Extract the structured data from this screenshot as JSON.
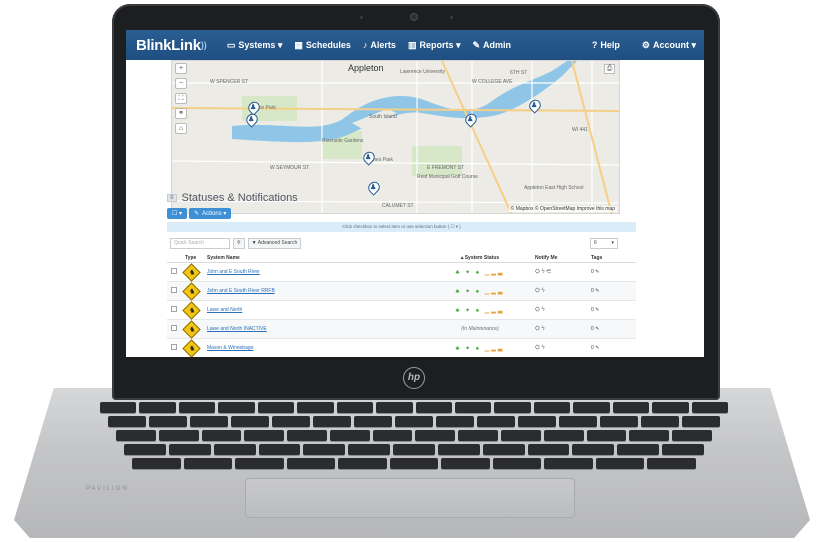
{
  "device": {
    "brand_logo": "hp",
    "model_text": "PAVILION"
  },
  "nav": {
    "brand": "BlinkLink",
    "brand_accent": "))",
    "items": [
      {
        "label": "Systems ▾",
        "icon": "monitor-icon"
      },
      {
        "label": "Schedules",
        "icon": "calendar-icon"
      },
      {
        "label": "Alerts",
        "icon": "bell-icon"
      },
      {
        "label": "Reports ▾",
        "icon": "bar-chart-icon"
      },
      {
        "label": "Admin",
        "icon": "wrench-icon"
      }
    ],
    "right": [
      {
        "label": "Help",
        "icon": "question-icon"
      },
      {
        "label": "Account ▾",
        "icon": "gear-icon"
      }
    ]
  },
  "map": {
    "city": "Appleton",
    "attribution": "© Mapbox © OpenStreetMap Improve this map",
    "labels": [
      "W SPENCER ST",
      "Pierce Park",
      "Riverside Gardens",
      "W SEYMOUR ST",
      "Jones Park",
      "South Island",
      "Lawrence University",
      "E FREMONT ST",
      "Reid Municipal Golf Course",
      "CALUMET ST",
      "Appleton East High School",
      "W COLLEGE AVE",
      "6TH ST",
      "WI 441"
    ]
  },
  "section": {
    "title": "Statuses & Notifications",
    "toggle": "≡",
    "buttons": [
      {
        "label": "☐ ▾"
      },
      {
        "label": "Actions ▾",
        "icon": "wrench-icon"
      }
    ],
    "info": "Click checkbox to select item or use selection button ( ☐ ▾ )",
    "quick_search_placeholder": "Quick Search",
    "advanced_search": "Advanced Search",
    "page_size": "6"
  },
  "grid": {
    "headers": [
      "Type",
      "System Name",
      "▴ System Status",
      "Notify Me",
      "Tags"
    ],
    "rows": [
      {
        "name": "John and E South River",
        "status": "icons",
        "notify": "⛭ ϟ ⚟",
        "tags": "0 ✎"
      },
      {
        "name": "John and E South River RRFB",
        "status": "icons",
        "notify": "⛭ ϟ",
        "tags": "0 ✎"
      },
      {
        "name": "Lawe and North",
        "status": "icons",
        "notify": "⛭ ϟ",
        "tags": "0 ✎"
      },
      {
        "name": "Lawe and North INACTIVE",
        "status": "(In Maintenance)",
        "notify": "⛭ ϟ",
        "tags": "0 ✎"
      },
      {
        "name": "Mason & Winnebago",
        "status": "icons",
        "notify": "⛭ ϟ",
        "tags": "0 ✎"
      }
    ]
  },
  "colors": {
    "nav": "#1f4f82",
    "primary_button": "#3f8fd4",
    "status_green": "#3fa535",
    "link": "#2c6fb6",
    "type_icon": "#f3c615"
  }
}
